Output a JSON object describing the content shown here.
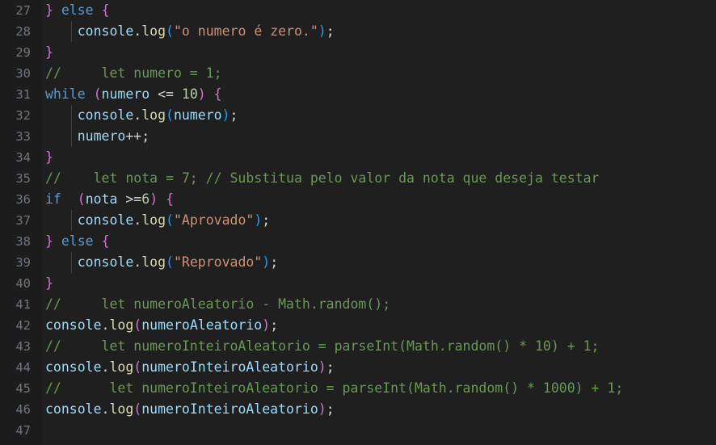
{
  "editor": {
    "theme": "dark-plus",
    "language": "javascript",
    "background_color": "#1f1f1f",
    "gutter_background_color": "#1c1c1c",
    "line_number_color": "#6e7681",
    "first_visible_line": 27,
    "last_visible_line": 47,
    "colors": {
      "keyword": "#569cd6",
      "variable": "#9cdcfe",
      "function": "#dcdcaa",
      "string": "#ce9178",
      "number": "#b5cea8",
      "comment": "#6a9955",
      "operator": "#d4d4d4",
      "bracket_level_1": "#da70d6",
      "bracket_level_2": "#179fff",
      "bracket_level_3": "#ffd700",
      "indent_guide": "#404040"
    }
  },
  "lines": [
    {
      "number": "27",
      "indent_guide": false,
      "text": "} else {",
      "tokens": [
        {
          "t": "}",
          "c": "b1"
        },
        {
          "t": " ",
          "c": "punc"
        },
        {
          "t": "else",
          "c": "kw"
        },
        {
          "t": " ",
          "c": "punc"
        },
        {
          "t": "{",
          "c": "b1"
        }
      ]
    },
    {
      "number": "28",
      "indent_guide": true,
      "text": "    console.log(\"o numero é zero.\");",
      "tokens": [
        {
          "t": "    ",
          "c": "punc"
        },
        {
          "t": "console",
          "c": "var"
        },
        {
          "t": ".",
          "c": "punc"
        },
        {
          "t": "log",
          "c": "fn"
        },
        {
          "t": "(",
          "c": "b2"
        },
        {
          "t": "\"o numero é zero.\"",
          "c": "str"
        },
        {
          "t": ")",
          "c": "b2"
        },
        {
          "t": ";",
          "c": "punc"
        }
      ]
    },
    {
      "number": "29",
      "indent_guide": false,
      "text": "}",
      "tokens": [
        {
          "t": "}",
          "c": "b1"
        }
      ]
    },
    {
      "number": "30",
      "indent_guide": false,
      "text": "//     let numero = 1;",
      "tokens": [
        {
          "t": "//     let numero = 1;",
          "c": "cmt"
        }
      ]
    },
    {
      "number": "31",
      "indent_guide": false,
      "text": "while (numero <= 10) {",
      "tokens": [
        {
          "t": "while",
          "c": "kw"
        },
        {
          "t": " ",
          "c": "punc"
        },
        {
          "t": "(",
          "c": "b1"
        },
        {
          "t": "numero",
          "c": "var"
        },
        {
          "t": " ",
          "c": "punc"
        },
        {
          "t": "<=",
          "c": "op"
        },
        {
          "t": " ",
          "c": "punc"
        },
        {
          "t": "10",
          "c": "num"
        },
        {
          "t": ")",
          "c": "b1"
        },
        {
          "t": " ",
          "c": "punc"
        },
        {
          "t": "{",
          "c": "b1"
        }
      ]
    },
    {
      "number": "32",
      "indent_guide": true,
      "text": "    console.log(numero);",
      "tokens": [
        {
          "t": "    ",
          "c": "punc"
        },
        {
          "t": "console",
          "c": "var"
        },
        {
          "t": ".",
          "c": "punc"
        },
        {
          "t": "log",
          "c": "fn"
        },
        {
          "t": "(",
          "c": "b2"
        },
        {
          "t": "numero",
          "c": "var"
        },
        {
          "t": ")",
          "c": "b2"
        },
        {
          "t": ";",
          "c": "punc"
        }
      ]
    },
    {
      "number": "33",
      "indent_guide": true,
      "text": "    numero++;",
      "tokens": [
        {
          "t": "    ",
          "c": "punc"
        },
        {
          "t": "numero",
          "c": "var"
        },
        {
          "t": "++",
          "c": "op"
        },
        {
          "t": ";",
          "c": "punc"
        }
      ]
    },
    {
      "number": "34",
      "indent_guide": false,
      "text": "}",
      "tokens": [
        {
          "t": "}",
          "c": "b1"
        }
      ]
    },
    {
      "number": "35",
      "indent_guide": false,
      "text": "//    let nota = 7; // Substitua pelo valor da nota que deseja testar",
      "tokens": [
        {
          "t": "//    let nota = 7; // Substitua pelo valor da nota que deseja testar",
          "c": "cmt"
        }
      ]
    },
    {
      "number": "36",
      "indent_guide": false,
      "text": "if  (nota >=6) {",
      "tokens": [
        {
          "t": "if",
          "c": "kw"
        },
        {
          "t": "  ",
          "c": "punc"
        },
        {
          "t": "(",
          "c": "b1"
        },
        {
          "t": "nota",
          "c": "var"
        },
        {
          "t": " ",
          "c": "punc"
        },
        {
          "t": ">=",
          "c": "op"
        },
        {
          "t": "6",
          "c": "num"
        },
        {
          "t": ")",
          "c": "b1"
        },
        {
          "t": " ",
          "c": "punc"
        },
        {
          "t": "{",
          "c": "b1"
        }
      ]
    },
    {
      "number": "37",
      "indent_guide": true,
      "text": "    console.log(\"Aprovado\");",
      "tokens": [
        {
          "t": "    ",
          "c": "punc"
        },
        {
          "t": "console",
          "c": "var"
        },
        {
          "t": ".",
          "c": "punc"
        },
        {
          "t": "log",
          "c": "fn"
        },
        {
          "t": "(",
          "c": "b2"
        },
        {
          "t": "\"Aprovado\"",
          "c": "str"
        },
        {
          "t": ")",
          "c": "b2"
        },
        {
          "t": ";",
          "c": "punc"
        }
      ]
    },
    {
      "number": "38",
      "indent_guide": false,
      "text": "} else {",
      "tokens": [
        {
          "t": "}",
          "c": "b1"
        },
        {
          "t": " ",
          "c": "punc"
        },
        {
          "t": "else",
          "c": "kw"
        },
        {
          "t": " ",
          "c": "punc"
        },
        {
          "t": "{",
          "c": "b1"
        }
      ]
    },
    {
      "number": "39",
      "indent_guide": true,
      "text": "    console.log(\"Reprovado\");",
      "tokens": [
        {
          "t": "    ",
          "c": "punc"
        },
        {
          "t": "console",
          "c": "var"
        },
        {
          "t": ".",
          "c": "punc"
        },
        {
          "t": "log",
          "c": "fn"
        },
        {
          "t": "(",
          "c": "b2"
        },
        {
          "t": "\"Reprovado\"",
          "c": "str"
        },
        {
          "t": ")",
          "c": "b2"
        },
        {
          "t": ";",
          "c": "punc"
        }
      ]
    },
    {
      "number": "40",
      "indent_guide": false,
      "text": "}",
      "tokens": [
        {
          "t": "}",
          "c": "b1"
        }
      ]
    },
    {
      "number": "41",
      "indent_guide": false,
      "text": "//     let numeroAleatorio - Math.random();",
      "tokens": [
        {
          "t": "//     let numeroAleatorio - Math.random();",
          "c": "cmt"
        }
      ]
    },
    {
      "number": "42",
      "indent_guide": false,
      "text": "console.log(numeroAleatorio);",
      "tokens": [
        {
          "t": "console",
          "c": "var"
        },
        {
          "t": ".",
          "c": "punc"
        },
        {
          "t": "log",
          "c": "fn"
        },
        {
          "t": "(",
          "c": "b1"
        },
        {
          "t": "numeroAleatorio",
          "c": "var"
        },
        {
          "t": ")",
          "c": "b1"
        },
        {
          "t": ";",
          "c": "punc"
        }
      ]
    },
    {
      "number": "43",
      "indent_guide": false,
      "text": "//     let numeroInteiroAleatorio = parseInt(Math.random() * 10) + 1;",
      "tokens": [
        {
          "t": "//     let numeroInteiroAleatorio = parseInt(Math.random() * 10) + 1;",
          "c": "cmt"
        }
      ]
    },
    {
      "number": "44",
      "indent_guide": false,
      "text": "console.log(numeroInteiroAleatorio);",
      "tokens": [
        {
          "t": "console",
          "c": "var"
        },
        {
          "t": ".",
          "c": "punc"
        },
        {
          "t": "log",
          "c": "fn"
        },
        {
          "t": "(",
          "c": "b1"
        },
        {
          "t": "numeroInteiroAleatorio",
          "c": "var"
        },
        {
          "t": ")",
          "c": "b1"
        },
        {
          "t": ";",
          "c": "punc"
        }
      ]
    },
    {
      "number": "45",
      "indent_guide": false,
      "text": "//      let numeroInteiroAleatorio = parseInt(Math.random() * 1000) + 1;",
      "tokens": [
        {
          "t": "//      let numeroInteiroAleatorio = parseInt(Math.random() * 1000) + 1;",
          "c": "cmt"
        }
      ]
    },
    {
      "number": "46",
      "indent_guide": false,
      "text": "console.log(numeroInteiroAleatorio);",
      "tokens": [
        {
          "t": "console",
          "c": "var"
        },
        {
          "t": ".",
          "c": "punc"
        },
        {
          "t": "log",
          "c": "fn"
        },
        {
          "t": "(",
          "c": "b1"
        },
        {
          "t": "numeroInteiroAleatorio",
          "c": "var"
        },
        {
          "t": ")",
          "c": "b1"
        },
        {
          "t": ";",
          "c": "punc"
        }
      ]
    },
    {
      "number": "47",
      "indent_guide": false,
      "text": "",
      "tokens": []
    }
  ]
}
